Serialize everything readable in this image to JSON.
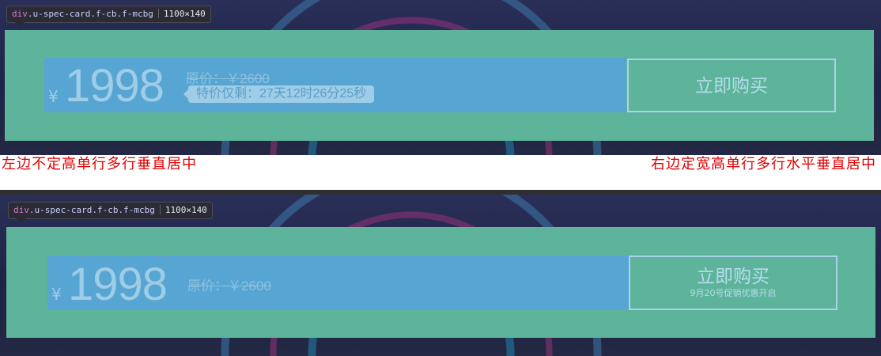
{
  "devtools_tooltip": {
    "tag": "div",
    "classes": ".u-spec-card.f-cb.f-mcbg",
    "size": "1100×140"
  },
  "card1": {
    "currency": "¥",
    "price": "1998",
    "original_price": "原价：￥2600",
    "countdown": "特价仅剩：27天12时26分25秒",
    "buy_label": "立即购买"
  },
  "notes": {
    "left": "左边不定高单行多行垂直居中",
    "right": "右边定宽高单行多行水平垂直居中"
  },
  "card2": {
    "currency": "¥",
    "price": "1998",
    "original_price": "原价：￥2600",
    "buy_label": "立即购买",
    "buy_sub": "9月20号促销优惠开启"
  },
  "colors": {
    "card_bg": "#5db49a",
    "inner_bg": "#57a5d2",
    "note_red": "#e00000"
  }
}
